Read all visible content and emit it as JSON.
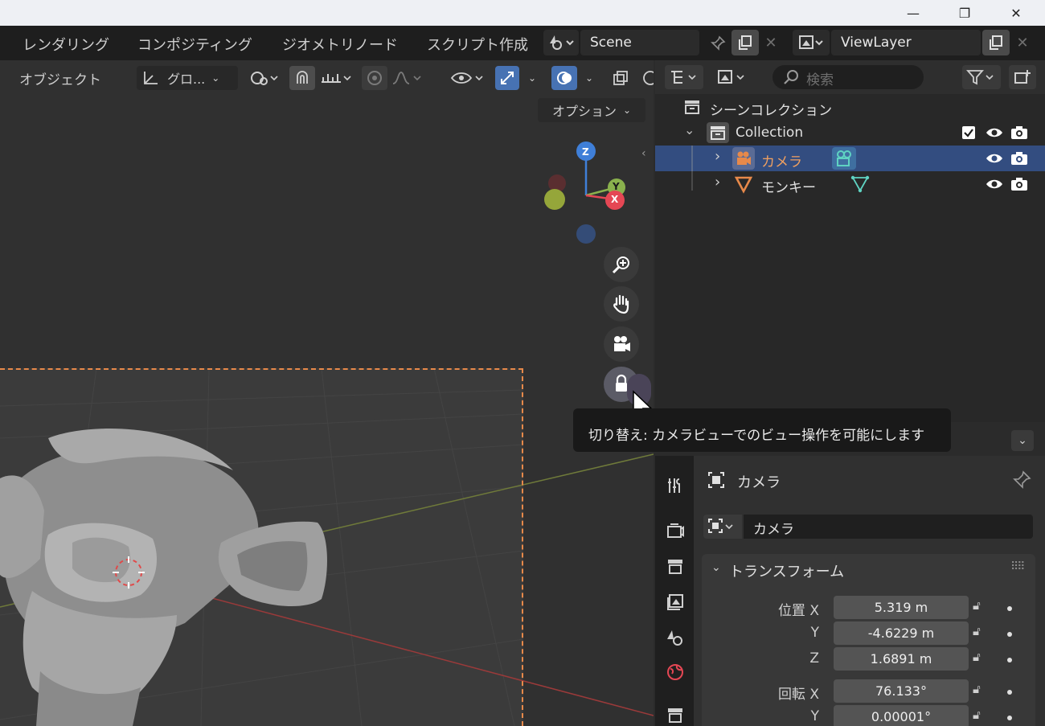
{
  "window": {
    "minimize_icon": "minimize-icon",
    "maximize_icon": "restore-icon",
    "close_icon": "close-icon",
    "minimize": "—",
    "maximize": "❐",
    "close": "✕"
  },
  "workspaces": [
    "レンダリング",
    "コンポジティング",
    "ジオメトリノード",
    "スクリプト作成"
  ],
  "scene": {
    "name": "Scene"
  },
  "view_layer": {
    "name": "ViewLayer"
  },
  "viewport": {
    "mode_label": "オブジェクト",
    "transform_orientation": "グロ...",
    "options_label": "オプション",
    "gizmo": {
      "z": "Z",
      "y": "Y",
      "x": "X"
    }
  },
  "outliner": {
    "search_placeholder": "検索",
    "scene_collection": "シーンコレクション",
    "collection": "Collection",
    "items": [
      {
        "name": "カメラ",
        "selected": true,
        "icon": "camera-object-icon"
      },
      {
        "name": "モンキー",
        "selected": false,
        "icon": "mesh-object-icon"
      }
    ]
  },
  "tooltip": {
    "text": "切り替え: カメラビューでのビュー操作を可能にします"
  },
  "properties": {
    "object_title": "カメラ",
    "object_name_field": "カメラ",
    "transform_header": "トランスフォーム",
    "location_label": "位置 X",
    "rotation_label": "回転 X",
    "y_label": "Y",
    "z_label": "Z",
    "location": {
      "x": "5.319 m",
      "y": "-4.6229 m",
      "z": "1.6891 m"
    },
    "rotation": {
      "x": "76.133°",
      "y": "0.00001°"
    }
  },
  "colors": {
    "accent_blue": "#4772b3",
    "selection_row": "#334d80",
    "camera_orange": "#e7894a",
    "axis_x": "#e54754",
    "axis_y": "#8ab14d",
    "axis_z": "#3f7fd8"
  }
}
